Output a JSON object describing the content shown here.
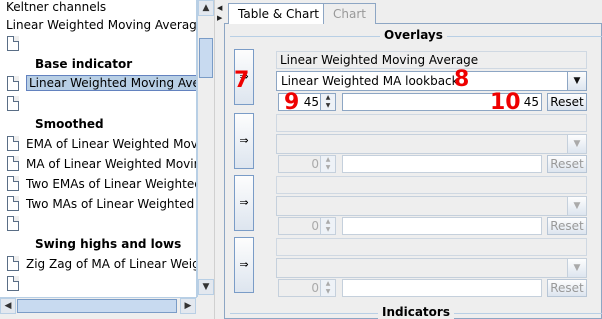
{
  "tree": {
    "items": [
      {
        "label": "Keltner channels",
        "kind": "plain"
      },
      {
        "label": "Linear Weighted Moving Average (L",
        "kind": "plain"
      },
      {
        "label": "",
        "kind": "doc"
      },
      {
        "label": "Base indicator",
        "kind": "header"
      },
      {
        "label": "Linear Weighted Moving Average",
        "kind": "selected"
      },
      {
        "label": "",
        "kind": "doc"
      },
      {
        "label": "Smoothed",
        "kind": "header"
      },
      {
        "label": "EMA of Linear Weighted Moving",
        "kind": "doc"
      },
      {
        "label": "MA of Linear Weighted Moving A",
        "kind": "doc"
      },
      {
        "label": "Two EMAs of Linear Weighted M",
        "kind": "doc"
      },
      {
        "label": "Two MAs of Linear Weighted Mo",
        "kind": "doc"
      },
      {
        "label": "",
        "kind": "doc"
      },
      {
        "label": "Swing highs and lows",
        "kind": "header"
      },
      {
        "label": "Zig Zag of MA of Linear Weighte",
        "kind": "doc"
      },
      {
        "label": "",
        "kind": "doc"
      }
    ]
  },
  "tabs": {
    "table_chart": "Table & Chart",
    "chart": "Chart"
  },
  "overlays": {
    "title": "Overlays",
    "rows": [
      {
        "arrow": "⇒",
        "name": "Linear Weighted Moving Average",
        "param": "Linear Weighted MA lookback",
        "spin": "45",
        "value": "45",
        "reset": "Reset",
        "enabled": true
      },
      {
        "arrow": "⇒",
        "name": "",
        "param": "",
        "spin": "0",
        "value": "",
        "reset": "Reset",
        "enabled": false
      },
      {
        "arrow": "⇒",
        "name": "",
        "param": "",
        "spin": "0",
        "value": "",
        "reset": "Reset",
        "enabled": false
      },
      {
        "arrow": "⇒",
        "name": "",
        "param": "",
        "spin": "0",
        "value": "",
        "reset": "Reset",
        "enabled": false
      }
    ]
  },
  "indicators": {
    "title": "Indicators"
  },
  "markers": {
    "m7": "7",
    "m8": "8",
    "m9": "9",
    "m10": "10"
  },
  "colors": {
    "marker": "#ee0000",
    "selection": "#b8cfe5"
  }
}
